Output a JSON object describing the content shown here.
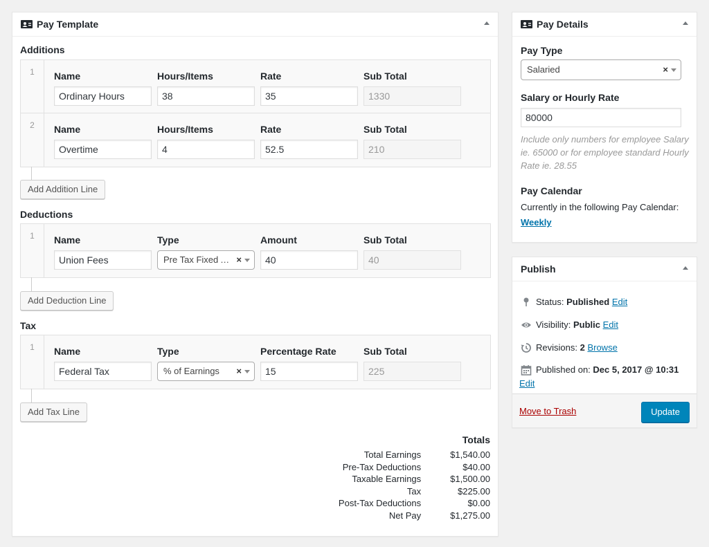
{
  "pay_template": {
    "title": "Pay Template",
    "additions": {
      "title": "Additions",
      "rows": [
        {
          "num": "1",
          "labels": [
            "Name",
            "Hours/Items",
            "Rate",
            "Sub Total"
          ],
          "values": [
            "Ordinary Hours",
            "38",
            "35",
            "1330"
          ]
        },
        {
          "num": "2",
          "labels": [
            "Name",
            "Hours/Items",
            "Rate",
            "Sub Total"
          ],
          "values": [
            "Overtime",
            "4",
            "52.5",
            "210"
          ]
        }
      ],
      "button": "Add Addition Line"
    },
    "deductions": {
      "title": "Deductions",
      "rows": [
        {
          "num": "1",
          "labels": [
            "Name",
            "Type",
            "Amount",
            "Sub Total"
          ],
          "name": "Union Fees",
          "type": "Pre Tax Fixed Amount",
          "amount": "40",
          "subtotal": "40"
        }
      ],
      "button": "Add Deduction Line"
    },
    "tax": {
      "title": "Tax",
      "rows": [
        {
          "num": "1",
          "labels": [
            "Name",
            "Type",
            "Percentage Rate",
            "Sub Total"
          ],
          "name": "Federal Tax",
          "type": "% of Earnings",
          "rate": "15",
          "subtotal": "225"
        }
      ],
      "button": "Add Tax Line"
    },
    "totals": {
      "title": "Totals",
      "rows": [
        {
          "label": "Total Earnings",
          "value": "$1,540.00"
        },
        {
          "label": "Pre-Tax Deductions",
          "value": "$40.00"
        },
        {
          "label": "Taxable Earnings",
          "value": "$1,500.00"
        },
        {
          "label": "Tax",
          "value": "$225.00"
        },
        {
          "label": "Post-Tax Deductions",
          "value": "$0.00"
        },
        {
          "label": "Net Pay",
          "value": "$1,275.00"
        }
      ]
    }
  },
  "pay_details": {
    "title": "Pay Details",
    "pay_type_label": "Pay Type",
    "pay_type_value": "Salaried",
    "rate_label": "Salary or Hourly Rate",
    "rate_value": "80000",
    "rate_help": "Include only numbers for employee Salary ie. 65000 or for employee standard Hourly Rate ie. 28.55",
    "calendar_label": "Pay Calendar",
    "calendar_text": "Currently in the following Pay Calendar:",
    "calendar_link": "Weekly"
  },
  "publish": {
    "title": "Publish",
    "status_label": "Status:",
    "status_value": "Published",
    "visibility_label": "Visibility:",
    "visibility_value": "Public",
    "revisions_label": "Revisions:",
    "revisions_value": "2",
    "browse_link": "Browse",
    "published_label": "Published on:",
    "published_value": "Dec 5, 2017 @ 10:31",
    "edit_link": "Edit",
    "trash_link": "Move to Trash",
    "update_button": "Update"
  },
  "colors": {
    "accent": "#0085ba",
    "link": "#0073aa",
    "trash": "#aa0000",
    "background": "#f1f1f1"
  }
}
